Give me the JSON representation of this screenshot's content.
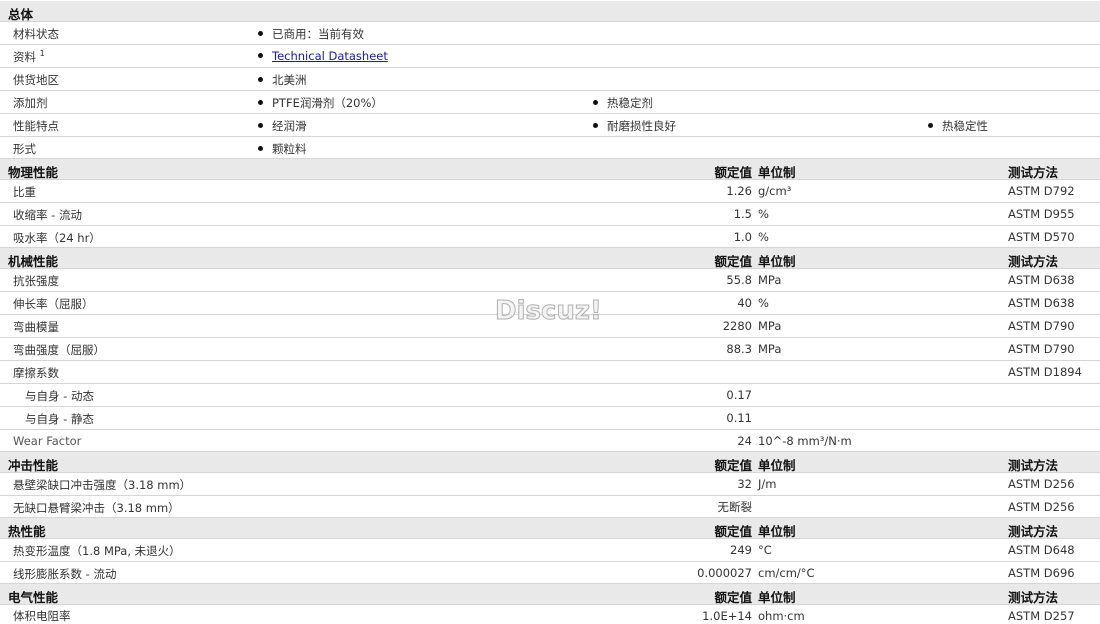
{
  "sections": {
    "general": {
      "title": "总体"
    },
    "physical": {
      "title": "物理性能",
      "col1": "额定值",
      "col2": "单位制",
      "col3": "测试方法"
    },
    "mechanical": {
      "title": "机械性能",
      "col1": "额定值",
      "col2": "单位制",
      "col3": "测试方法"
    },
    "impact": {
      "title": "冲击性能",
      "col1": "额定值",
      "col2": "单位制",
      "col3": "测试方法"
    },
    "thermal": {
      "title": "热性能",
      "col1": "额定值",
      "col2": "单位制",
      "col3": "测试方法"
    },
    "electrical": {
      "title": "电气性能",
      "col1": "额定值",
      "col2": "单位制",
      "col3": "测试方法"
    }
  },
  "general": {
    "status_label": "材料状态",
    "status_value": "已商用：当前有效",
    "docs_label": "资料",
    "docs_sup": "1",
    "docs_link": "Technical Datasheet",
    "region_label": "供货地区",
    "region_value": "北美洲",
    "additive_label": "添加剂",
    "additive_1": "PTFE润滑剂（20%）",
    "additive_2": "热稳定剂",
    "feature_label": "性能特点",
    "feature_1": "经润滑",
    "feature_2": "耐磨损性良好",
    "feature_3": "热稳定性",
    "form_label": "形式",
    "form_value": "颗粒料"
  },
  "physical_rows": [
    {
      "label": "比重",
      "value": "1.26",
      "unit": "g/cm³",
      "method": "ASTM D792"
    },
    {
      "label": "收缩率  - 流动",
      "value": "1.5",
      "unit": "%",
      "method": "ASTM D955"
    },
    {
      "label": "吸水率（24 hr）",
      "value": "1.0",
      "unit": "%",
      "method": "ASTM D570"
    }
  ],
  "mechanical_rows": [
    {
      "label": "抗张强度",
      "value": "55.8",
      "unit": "MPa",
      "method": "ASTM D638"
    },
    {
      "label": "伸长率（屈服）",
      "value": "40",
      "unit": "%",
      "method": "ASTM D638"
    },
    {
      "label": "弯曲模量",
      "value": "2280",
      "unit": "MPa",
      "method": "ASTM D790"
    },
    {
      "label": "弯曲强度（屈服）",
      "value": "88.3",
      "unit": "MPa",
      "method": "ASTM D790"
    },
    {
      "label": "摩擦系数",
      "value": "",
      "unit": "",
      "method": "ASTM D1894"
    },
    {
      "label": "与自身  - 动态",
      "value": "0.17",
      "unit": "",
      "method": ""
    },
    {
      "label": "与自身  - 静态",
      "value": "0.11",
      "unit": "",
      "method": ""
    },
    {
      "label": "Wear Factor",
      "value": "24",
      "unit": "10^-8 mm³/N·m",
      "method": ""
    }
  ],
  "impact_rows": [
    {
      "label": "悬壁梁缺口冲击强度（3.18 mm）",
      "value": "32",
      "unit": "J/m",
      "method": "ASTM D256"
    },
    {
      "label": "无缺口悬臂梁冲击（3.18 mm）",
      "value": "无断裂",
      "unit": "",
      "method": "ASTM D256"
    }
  ],
  "thermal_rows": [
    {
      "label": "热变形温度（1.8 MPa, 未退火）",
      "value": "249",
      "unit": "°C",
      "method": "ASTM D648"
    },
    {
      "label": "线形膨胀系数  - 流动",
      "value": "0.000027",
      "unit": "cm/cm/°C",
      "method": "ASTM D696"
    }
  ],
  "electrical_rows": [
    {
      "label": "体积电阻率",
      "value": "1.0E+14",
      "unit": "ohm·cm",
      "method": "ASTM D257"
    }
  ],
  "watermark": "Discuz!"
}
